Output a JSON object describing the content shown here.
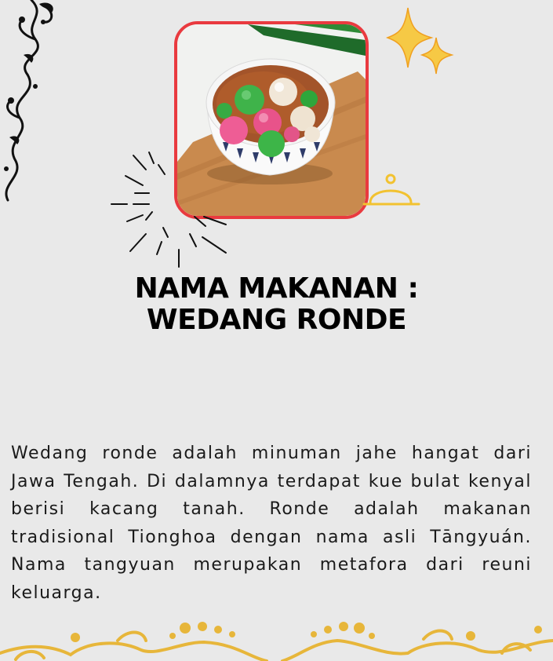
{
  "title": {
    "line1": "NAMA MAKANAN :",
    "line2": "WEDANG RONDE"
  },
  "description": "Wedang ronde adalah minuman jahe hangat dari Jawa Tengah. Di dalamnya terdapat kue bulat kenyal berisi kacang tanah. Ronde adalah makanan tradisional Tionghoa dengan nama asli Tāngyuán. Nama tangyuan merupakan metafora dari reuni keluarga.",
  "colors": {
    "background": "#e9e9e9",
    "frame_border": "#e93a3f",
    "accent_gold": "#f2c230",
    "ornament_gold": "#e7b63a"
  },
  "icons": [
    "swirl-ornament",
    "sparkle-icon",
    "cloche-icon",
    "burst-lines",
    "gold-border-ornament"
  ]
}
